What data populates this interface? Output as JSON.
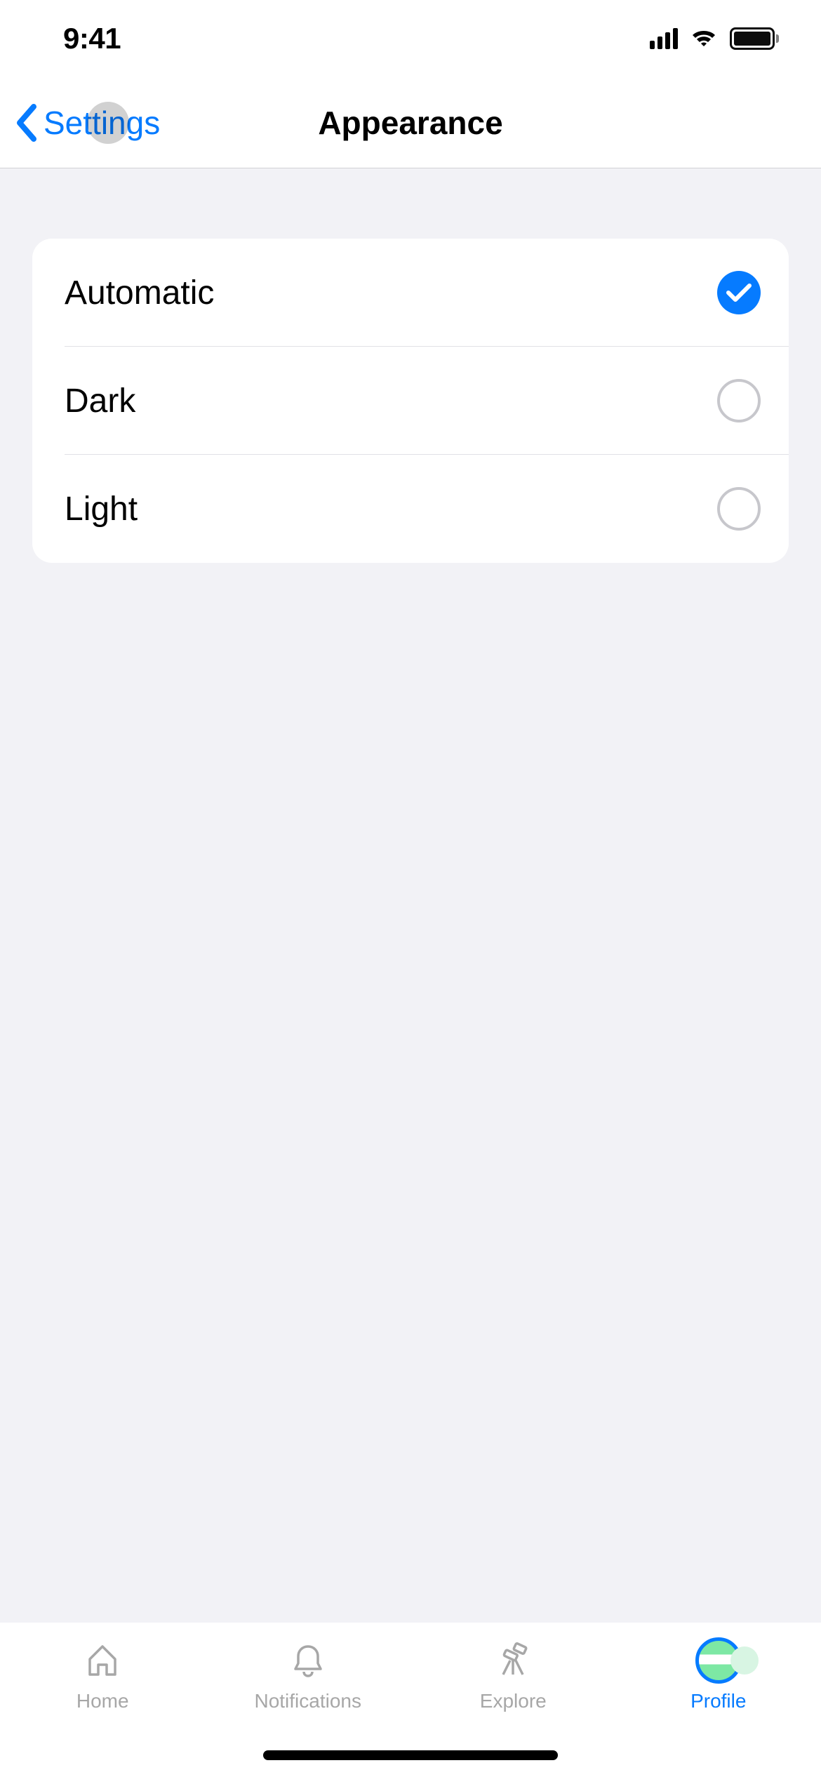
{
  "statusBar": {
    "time": "9:41"
  },
  "nav": {
    "backLabel": "Settings",
    "title": "Appearance"
  },
  "options": [
    {
      "label": "Automatic",
      "selected": true
    },
    {
      "label": "Dark",
      "selected": false
    },
    {
      "label": "Light",
      "selected": false
    }
  ],
  "tabs": {
    "home": "Home",
    "notifications": "Notifications",
    "explore": "Explore",
    "profile": "Profile"
  },
  "colors": {
    "accent": "#067bff"
  }
}
